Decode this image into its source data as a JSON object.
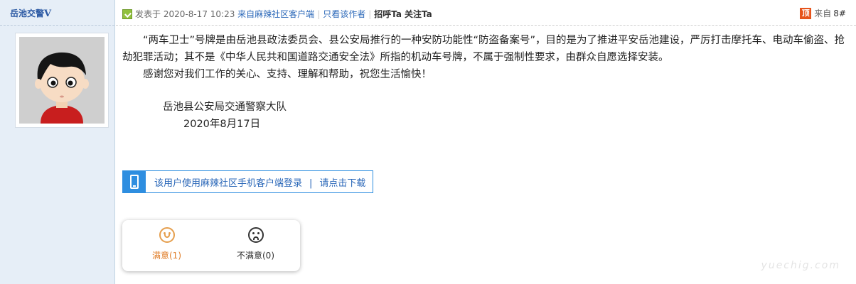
{
  "user": {
    "name": "岳池交警",
    "badge": "V"
  },
  "post_header": {
    "posted_prefix": "发表于",
    "datetime": "2020-8-17 10:23",
    "from_client": "来自麻辣社区客户端",
    "only_author": "只看该作者",
    "greet": "招呼Ta",
    "follow": "关注Ta",
    "top_icon": "顶",
    "from_floor": "来自",
    "floor": "8#"
  },
  "content": {
    "paragraph1": "“两车卫士”号牌是由岳池县政法委员会、县公安局推行的一种安防功能性“防盗备案号”，目的是为了推进平安岳池建设，严厉打击摩托车、电动车偷盗、抢劫犯罪活动；其不是《中华人民共和国道路交通安全法》所指的机动车号牌，不属于强制性要求，由群众自愿选择安装。",
    "paragraph2": "感谢您对我们工作的关心、支持、理解和帮助，祝您生活愉快！",
    "signature": "岳池县公安局交通警察大队",
    "date": "2020年8月17日"
  },
  "app_banner": {
    "text": "该用户使用麻辣社区手机客户端登录",
    "separator": "|",
    "download": "请点击下载",
    "icon": "mobile-phone-icon"
  },
  "rating": {
    "satisfied_label": "满意(1)",
    "unsatisfied_label": "不满意(0)",
    "satisfied_icon": "smile-icon",
    "unsatisfied_icon": "frown-icon"
  },
  "watermark": "yuechig.com",
  "colors": {
    "link": "#2a67b8",
    "sidebar_bg": "#e6eef7",
    "accent_orange": "#e07d28",
    "banner_blue": "#2e8ee0"
  }
}
